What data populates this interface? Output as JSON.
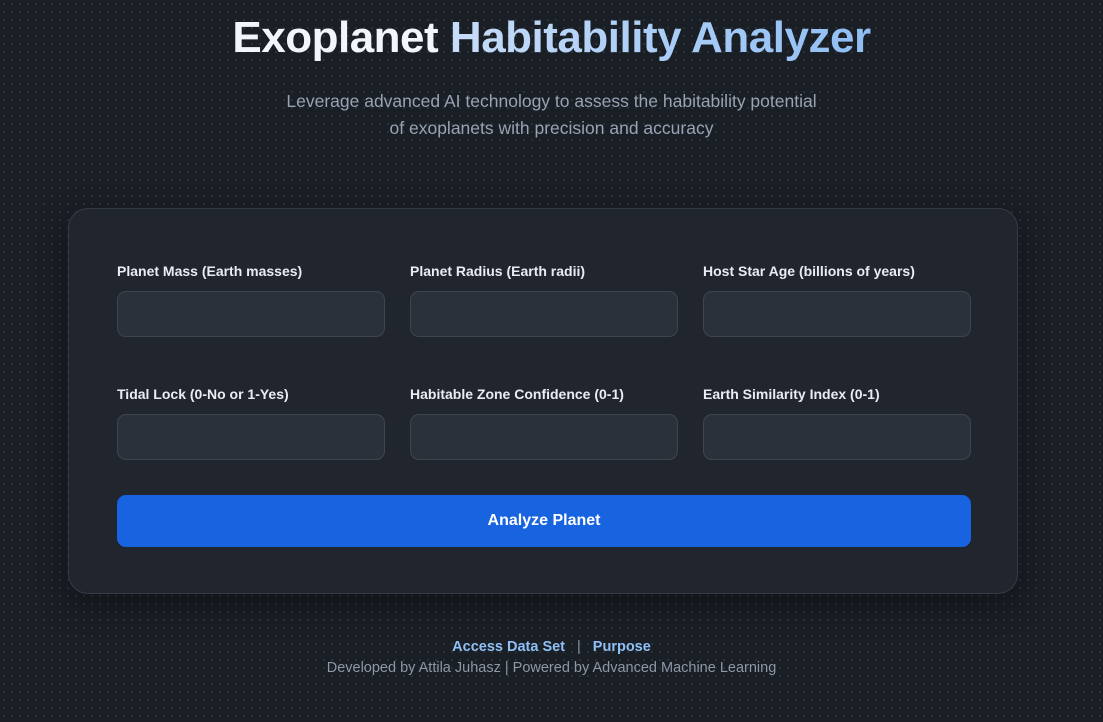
{
  "header": {
    "title_part1": "Exoplanet",
    "title_part2": "Habitability Analyzer",
    "subtitle_line1": "Leverage advanced AI technology to assess the habitability potential",
    "subtitle_line2": "of exoplanets with precision and accuracy"
  },
  "form": {
    "fields": [
      {
        "label": "Planet Mass (Earth masses)",
        "value": "",
        "placeholder": ""
      },
      {
        "label": "Planet Radius (Earth radii)",
        "value": "",
        "placeholder": ""
      },
      {
        "label": "Host Star Age (billions of years)",
        "value": "",
        "placeholder": ""
      },
      {
        "label": "Tidal Lock (0-No or 1-Yes)",
        "value": "",
        "placeholder": ""
      },
      {
        "label": "Habitable Zone Confidence (0-1)",
        "value": "",
        "placeholder": ""
      },
      {
        "label": "Earth Similarity Index (0-1)",
        "value": "",
        "placeholder": ""
      }
    ],
    "submit_label": "Analyze Planet"
  },
  "footer": {
    "link1": "Access Data Set",
    "separator": "|",
    "link2": "Purpose",
    "credits": "Developed by Attila Juhasz | Powered by Advanced Machine Learning"
  },
  "colors": {
    "background": "#1a1e25",
    "card": "#21262e",
    "accent": "#1763e0",
    "link": "#8fc0f5"
  }
}
